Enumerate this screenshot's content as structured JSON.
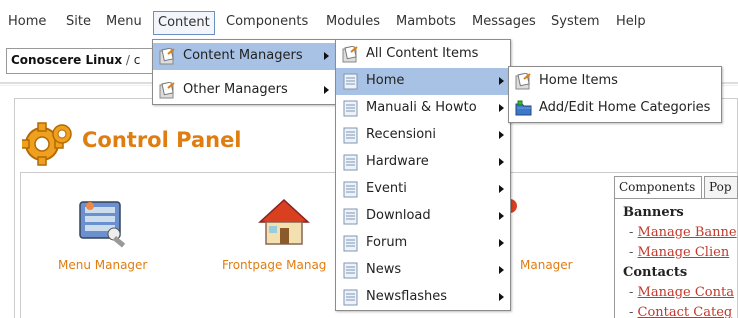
{
  "menubar": {
    "items": [
      "Home",
      "Site",
      "Menu",
      "Content",
      "Components",
      "Modules",
      "Mambots",
      "Messages",
      "System",
      "Help"
    ],
    "active": "Content"
  },
  "pathbar": {
    "site": "Conoscere Linux",
    "separator": "/",
    "rest": "c"
  },
  "control_panel": {
    "title": "Control Panel",
    "quick_links": [
      "Menu Manager",
      "Frontpage Manag",
      "Manager"
    ]
  },
  "right_panel": {
    "tabs": [
      "Components",
      "Pop"
    ],
    "sections": [
      {
        "title": "Banners",
        "links": [
          "Manage Banne",
          "Manage Clien"
        ]
      },
      {
        "title": "Contacts",
        "links": [
          "Manage Conta",
          "Contact Categ"
        ]
      }
    ]
  },
  "content_menu": {
    "items": [
      {
        "label": "Content Managers",
        "icon": "content-icon",
        "submenu": true,
        "highlighted": true
      },
      {
        "label": "Other Managers",
        "icon": "content-icon",
        "submenu": true,
        "highlighted": false
      }
    ]
  },
  "content_managers_menu": {
    "items": [
      {
        "label": "All Content Items",
        "icon": "content-icon",
        "submenu": false,
        "highlighted": false
      },
      {
        "label": "Home",
        "icon": "document-icon",
        "submenu": true,
        "highlighted": true
      },
      {
        "label": "Manuali & Howto",
        "icon": "document-icon",
        "submenu": true,
        "highlighted": false
      },
      {
        "label": "Recensioni",
        "icon": "document-icon",
        "submenu": true,
        "highlighted": false
      },
      {
        "label": "Hardware",
        "icon": "document-icon",
        "submenu": true,
        "highlighted": false
      },
      {
        "label": "Eventi",
        "icon": "document-icon",
        "submenu": true,
        "highlighted": false
      },
      {
        "label": "Download",
        "icon": "document-icon",
        "submenu": true,
        "highlighted": false
      },
      {
        "label": "Forum",
        "icon": "document-icon",
        "submenu": true,
        "highlighted": false
      },
      {
        "label": "News",
        "icon": "document-icon",
        "submenu": true,
        "highlighted": false
      },
      {
        "label": "Newsflashes",
        "icon": "document-icon",
        "submenu": true,
        "highlighted": false
      }
    ]
  },
  "home_menu": {
    "items": [
      {
        "label": "Home Items",
        "icon": "content-icon"
      },
      {
        "label": "Add/Edit Home Categories",
        "icon": "folder-icon"
      }
    ]
  },
  "colors": {
    "accent": "#e07d10",
    "highlight": "#a8c2e6",
    "link": "#c0392b"
  }
}
